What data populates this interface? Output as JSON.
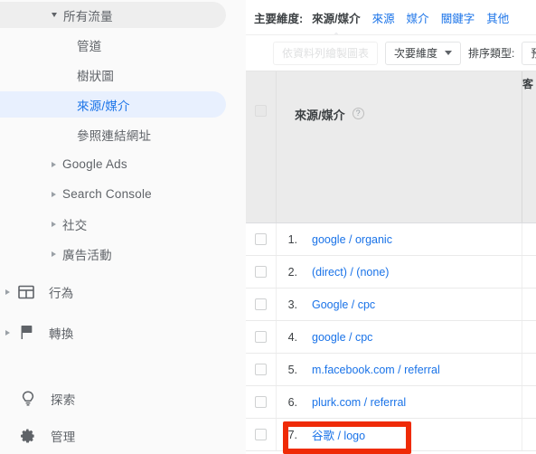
{
  "sidebar": {
    "items": [
      {
        "label": "所有流量",
        "icon": "caret-down-icon",
        "caret": "down",
        "indent": "group",
        "state": "expanded-selected-group"
      },
      {
        "label": "管道",
        "icon": "",
        "caret": "none",
        "indent": "child",
        "state": "normal"
      },
      {
        "label": "樹狀圖",
        "icon": "",
        "caret": "none",
        "indent": "child",
        "state": "normal"
      },
      {
        "label": "來源/媒介",
        "icon": "",
        "caret": "none",
        "indent": "child",
        "state": "selected"
      },
      {
        "label": "參照連結網址",
        "icon": "",
        "caret": "none",
        "indent": "child",
        "state": "normal"
      },
      {
        "label": "Google Ads",
        "icon": "caret-right-icon",
        "caret": "right",
        "indent": "sub",
        "state": "normal"
      },
      {
        "label": "Search Console",
        "icon": "caret-right-icon",
        "caret": "right",
        "indent": "sub",
        "state": "normal"
      },
      {
        "label": "社交",
        "icon": "caret-right-icon",
        "caret": "right",
        "indent": "sub",
        "state": "normal"
      },
      {
        "label": "廣告活動",
        "icon": "caret-right-icon",
        "caret": "right",
        "indent": "sub",
        "state": "normal"
      }
    ],
    "sections": [
      {
        "label": "行為",
        "icon": "behavior-icon",
        "caret": "right"
      },
      {
        "label": "轉換",
        "icon": "flag-icon",
        "caret": "right"
      }
    ],
    "footer": [
      {
        "label": "探索",
        "icon": "lightbulb-icon"
      },
      {
        "label": "管理",
        "icon": "gear-icon"
      }
    ]
  },
  "dimension_bar": {
    "label": "主要維度:",
    "tabs": [
      {
        "label": "來源/媒介",
        "active": true
      },
      {
        "label": "來源",
        "active": false
      },
      {
        "label": "媒介",
        "active": false
      },
      {
        "label": "關鍵字",
        "active": false
      },
      {
        "label": "其他",
        "active": false
      }
    ]
  },
  "toolbar": {
    "plot_rows_label": "依資料列繪製圖表",
    "secondary_dimension_label": "次要維度",
    "sort_type_label": "排序類型:",
    "sort_type_value": "預設"
  },
  "table": {
    "header": {
      "dimension_label": "來源/媒介",
      "help_icon": "help-icon",
      "metric_label_partial": "客"
    },
    "rows": [
      {
        "index": "1.",
        "name": "google / organic"
      },
      {
        "index": "2.",
        "name": "(direct) / (none)"
      },
      {
        "index": "3.",
        "name": "Google / cpc"
      },
      {
        "index": "4.",
        "name": "google / cpc"
      },
      {
        "index": "5.",
        "name": "m.facebook.com / referral"
      },
      {
        "index": "6.",
        "name": "plurk.com / referral"
      },
      {
        "index": "7.",
        "name": "谷歌 / logo"
      }
    ]
  },
  "annotation": {
    "target_row_index": 6,
    "color": "#ef2b07"
  },
  "colors": {
    "accent_blue": "#1a73e8",
    "selected_pill": "#e8f0fe",
    "group_pill": "#eeeeee",
    "header_bg": "#ebebeb",
    "annotation_red": "#ef2b07"
  }
}
